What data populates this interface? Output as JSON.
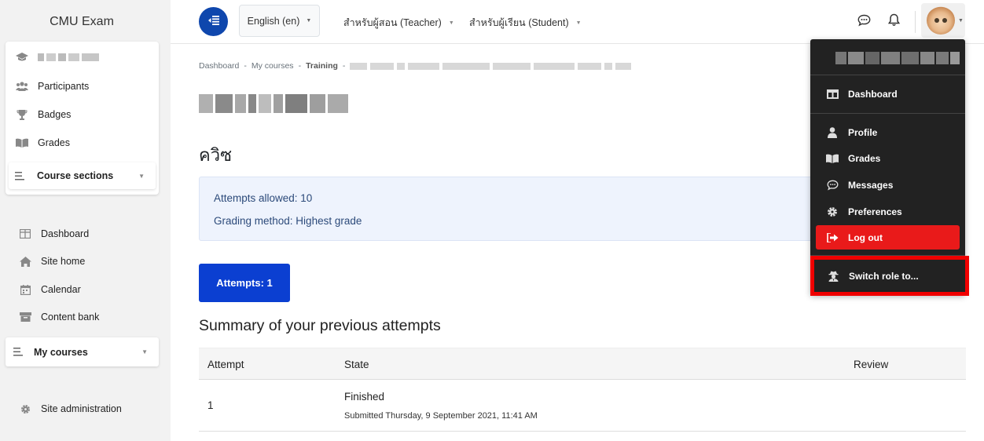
{
  "site": {
    "title": "CMU Exam"
  },
  "course_nav": {
    "items": [
      {
        "label": "Participants",
        "icon": "users-icon"
      },
      {
        "label": "Badges",
        "icon": "trophy-icon"
      },
      {
        "label": "Grades",
        "icon": "book-icon"
      }
    ],
    "sections_label": "Course sections"
  },
  "site_nav": {
    "items": [
      {
        "label": "Dashboard",
        "icon": "dashboard-icon"
      },
      {
        "label": "Site home",
        "icon": "home-icon"
      },
      {
        "label": "Calendar",
        "icon": "calendar-icon"
      },
      {
        "label": "Content bank",
        "icon": "box-icon"
      }
    ],
    "my_courses_label": "My courses",
    "admin_label": "Site administration"
  },
  "navbar": {
    "language": "English (en)",
    "teacher_menu": "สำหรับผู้สอน (Teacher)",
    "student_menu": "สำหรับผู้เรียน (Student)"
  },
  "breadcrumb": {
    "items": [
      "Dashboard",
      "My courses",
      "Training"
    ]
  },
  "quiz": {
    "title": "ควิซ",
    "attempts_allowed": "Attempts allowed: 10",
    "grading_method": "Grading method: Highest grade",
    "attempts_button": "Attempts: 1",
    "summary_title": "Summary of your previous attempts"
  },
  "attempts_table": {
    "headers": {
      "attempt": "Attempt",
      "state": "State",
      "review": "Review"
    },
    "rows": [
      {
        "attempt": "1",
        "state": "Finished",
        "submitted": "Submitted Thursday, 9 September 2021, 11:41 AM"
      }
    ]
  },
  "user_menu": {
    "dashboard": "Dashboard",
    "profile": "Profile",
    "grades": "Grades",
    "messages": "Messages",
    "preferences": "Preferences",
    "logout": "Log out",
    "switch_role": "Switch role to..."
  },
  "colors": {
    "primary": "#0f47ad",
    "attempts_button": "#0b3fd1",
    "logout": "#e91a1a",
    "highlight": "#f00000",
    "menu_bg": "#222222"
  }
}
